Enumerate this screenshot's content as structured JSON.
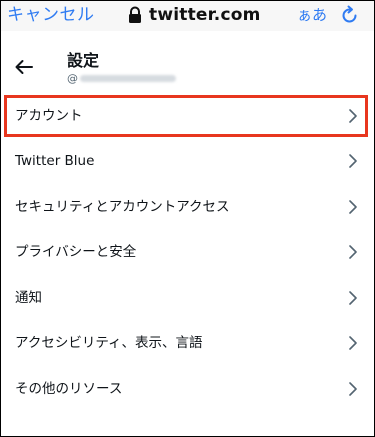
{
  "browser": {
    "cancel_label": "キャンセル",
    "url": "twitter.com",
    "text_size_label": "ぁあ",
    "icons": {
      "lock": "lock-icon",
      "reload": "reload-icon"
    },
    "accent_color": "#2f7bf2"
  },
  "header": {
    "title": "設定",
    "handle_prefix": "@",
    "back_icon": "arrow-left-icon"
  },
  "menu": {
    "items": [
      {
        "label": "アカウント"
      },
      {
        "label": "Twitter Blue"
      },
      {
        "label": "セキュリティとアカウントアクセス"
      },
      {
        "label": "プライバシーと安全"
      },
      {
        "label": "通知"
      },
      {
        "label": "アクセシビリティ、表示、言語"
      },
      {
        "label": "その他のリソース"
      }
    ],
    "item_icon": "chevron-right-icon",
    "highlighted_item": "アカウント",
    "highlight_color": "#e8361e"
  }
}
